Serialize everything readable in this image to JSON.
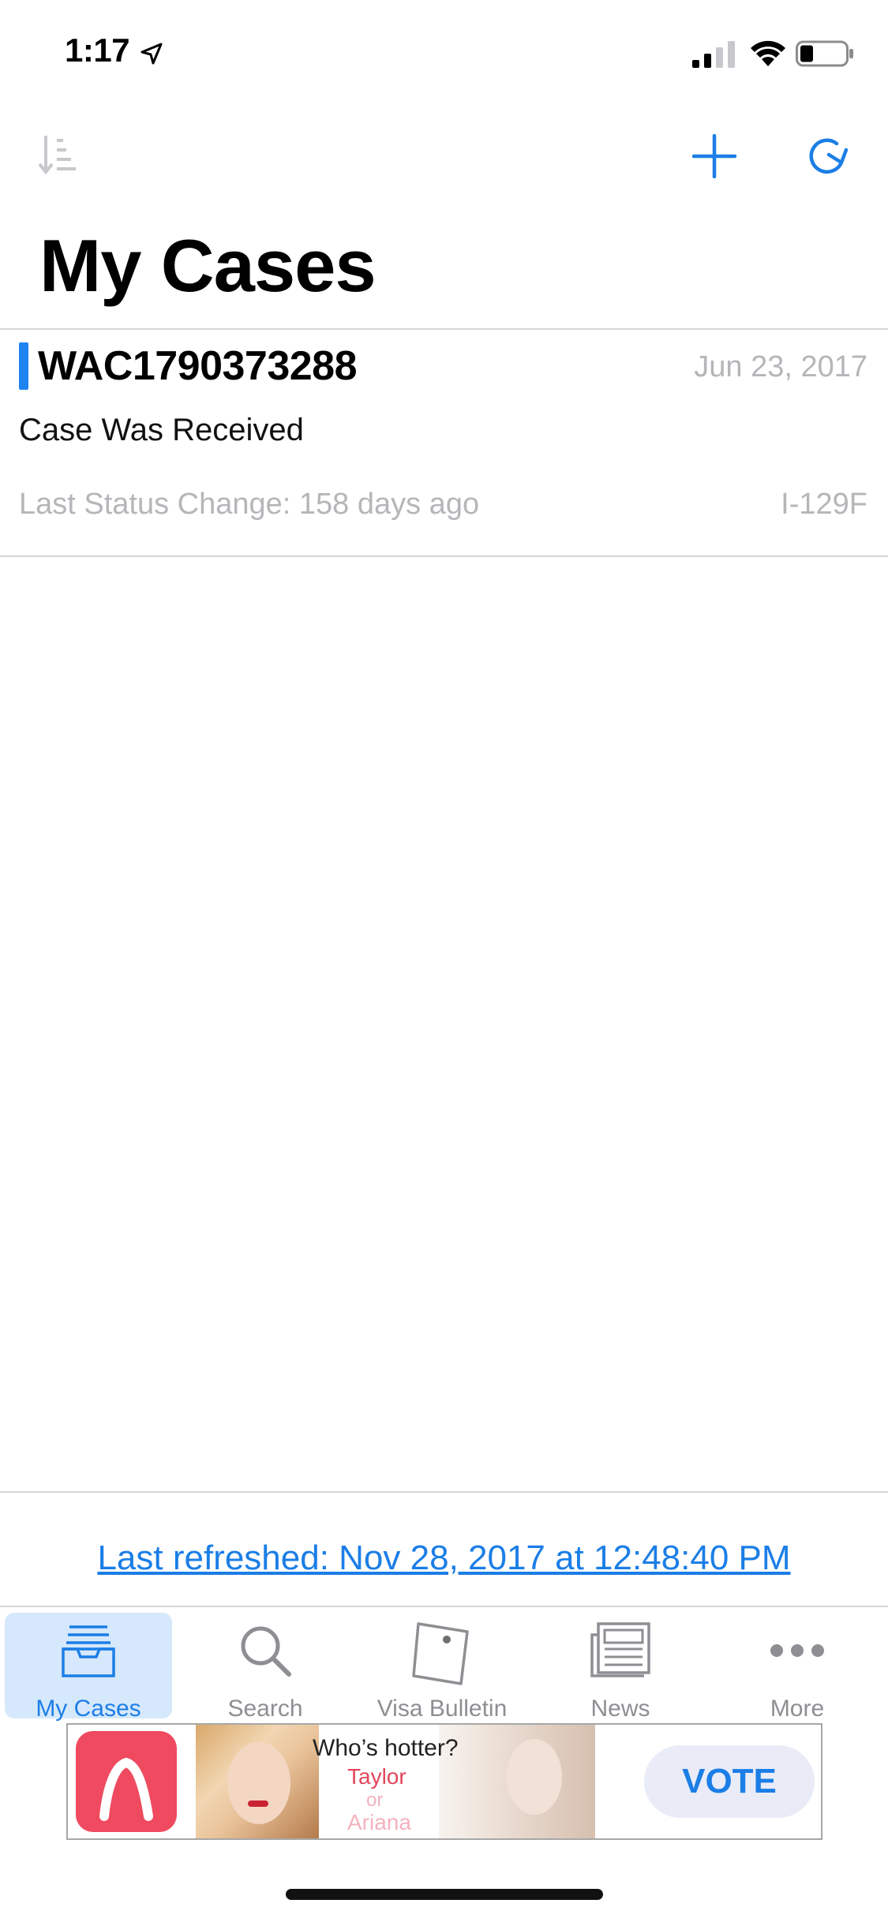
{
  "status_bar": {
    "time": "1:17"
  },
  "nav": {
    "title": "My Cases"
  },
  "cases": [
    {
      "receipt_number": "WAC1790373288",
      "date": "Jun 23, 2017",
      "status": "Case Was Received",
      "last_change": "Last Status Change: 158 days ago",
      "form": "I-129F",
      "accent_color": "#1e84f2"
    }
  ],
  "footer": {
    "last_refreshed": "Last refreshed: Nov 28, 2017 at 12:48:40 PM"
  },
  "tabs": [
    {
      "label": "My Cases",
      "icon": "inbox-tray-icon",
      "selected": true
    },
    {
      "label": "Search",
      "icon": "search-icon",
      "selected": false
    },
    {
      "label": "Visa Bulletin",
      "icon": "bulletin-note-icon",
      "selected": false
    },
    {
      "label": "News",
      "icon": "newspaper-icon",
      "selected": false
    },
    {
      "label": "More",
      "icon": "more-dots-icon",
      "selected": false
    }
  ],
  "ad": {
    "question": "Who’s hotter?",
    "option_1": "Taylor",
    "or": "or",
    "option_2": "Ariana",
    "cta": "VOTE"
  },
  "colors": {
    "accent": "#1b7ee6",
    "selected_tab_bg": "#d6e8fb",
    "secondary_text": "#b6b6ba"
  }
}
